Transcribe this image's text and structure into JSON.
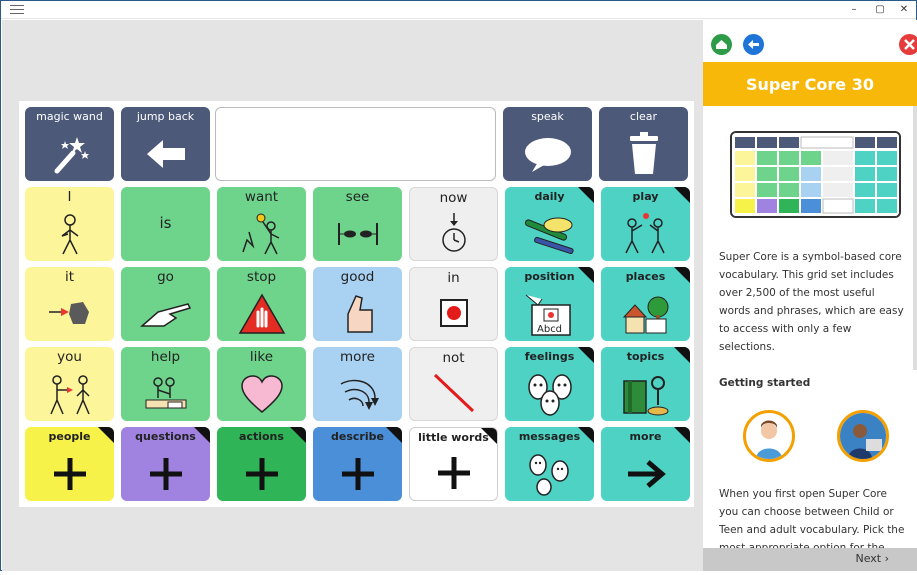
{
  "window": {
    "minimize": "–",
    "maximize": "▢",
    "close": "✕"
  },
  "board": {
    "controls": {
      "magic_wand": "magic wand",
      "jump_back": "jump back",
      "speak": "speak",
      "clear": "clear"
    },
    "rows": [
      [
        "I",
        "is",
        "want",
        "see",
        "now",
        "daily",
        "play"
      ],
      [
        "it",
        "go",
        "stop",
        "good",
        "in",
        "position",
        "places"
      ],
      [
        "you",
        "help",
        "like",
        "more",
        "not",
        "feelings",
        "topics"
      ],
      [
        "people",
        "questions",
        "actions",
        "describe",
        "little words",
        "messages",
        "more"
      ]
    ],
    "position_card_text": "Abcd"
  },
  "side": {
    "title": "Super Core 30",
    "intro": "Super Core is a symbol-based core vocabulary. This grid set includes over 2,500 of the most useful words and phrases, which are easy to access with only a few selections.",
    "getting_started": "Getting started",
    "body": "When you first open Super Core you can choose between Child or Teen and adult vocabulary. Pick the most appropriate option for the AAC",
    "next": "Next ›"
  },
  "colors": {
    "dark_tile": "#4c5979",
    "yellow_tile": "#fdf59a",
    "green_tile": "#6ed48c",
    "blue_tile": "#a8d1f2",
    "teal_tile": "#4dd2c4",
    "banner": "#f8b80a"
  },
  "icons": {
    "home": "home-icon",
    "back": "back-arrow-icon",
    "close": "close-icon"
  }
}
